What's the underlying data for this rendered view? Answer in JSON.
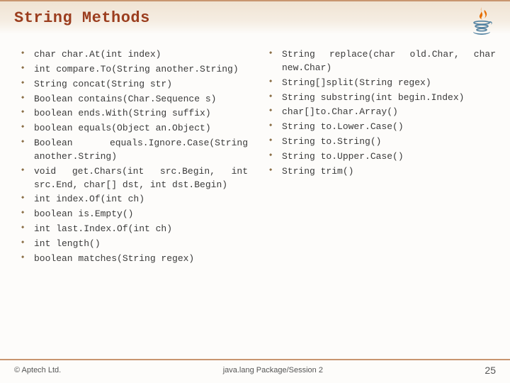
{
  "header": {
    "title": "String Methods"
  },
  "left_column": [
    "char char.At(int index)",
    "int compare.To(String another.String)",
    "String concat(String str)",
    "Boolean contains(Char.Sequence s)",
    "boolean ends.With(String suffix)",
    "boolean equals(Object an.Object)",
    "Boolean equals.Ignore.Case(String another.String)",
    "void get.Chars(int src.Begin, int src.End, char[] dst, int dst.Begin)",
    "int index.Of(int ch)",
    "boolean is.Empty()",
    "int last.Index.Of(int ch)",
    "int length()",
    "boolean matches(String regex)"
  ],
  "right_column": [
    "String replace(char old.Char, char new.Char)",
    "String[]split(String regex)",
    "String substring(int begin.Index)",
    "char[]to.Char.Array()",
    "String to.Lower.Case()",
    "String to.String()",
    "String to.Upper.Case()",
    "String trim()"
  ],
  "footer": {
    "copyright": "© Aptech Ltd.",
    "center": "java.lang Package/Session 2",
    "page": "25"
  }
}
